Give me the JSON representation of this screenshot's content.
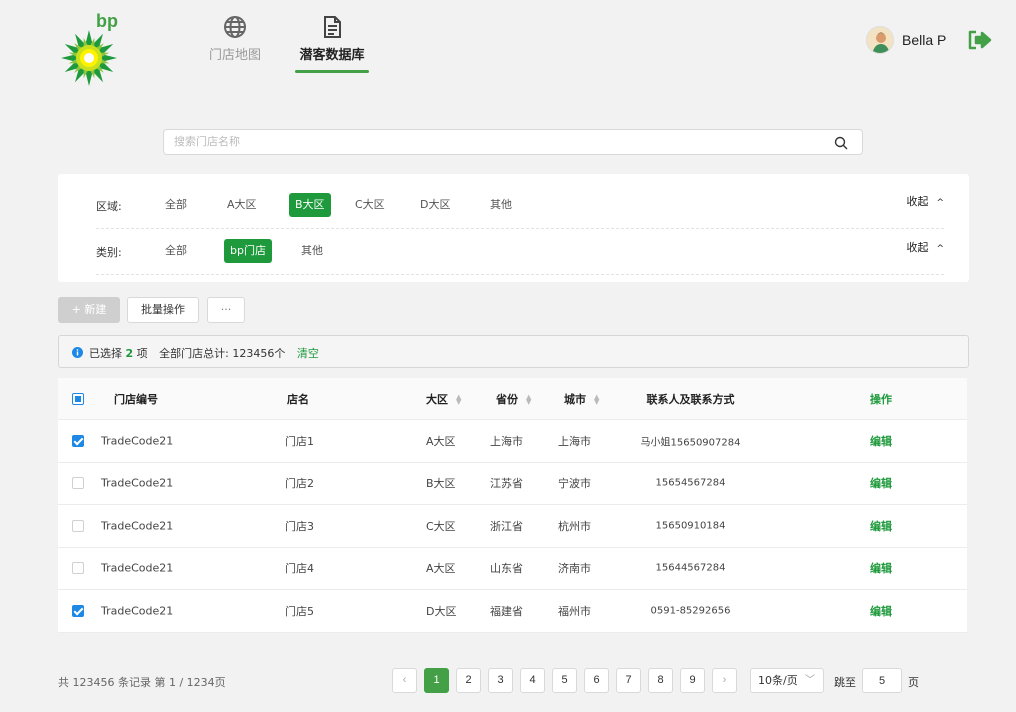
{
  "brand": {
    "logo_text": "bp",
    "accent": "#1e9a3c"
  },
  "nav": {
    "items": [
      {
        "label": "门店地图",
        "icon": "globe-icon",
        "active": false
      },
      {
        "label": "潜客数据库",
        "icon": "document-icon",
        "active": true
      }
    ]
  },
  "user": {
    "name": "Bella P",
    "avatar": "avatar",
    "logout_icon": "logout-icon"
  },
  "search": {
    "placeholder": "搜索门店名称",
    "value": ""
  },
  "filters": {
    "rows": [
      {
        "label": "区域:",
        "options": [
          "全部",
          "A大区",
          "B大区",
          "C大区",
          "D大区",
          "其他"
        ],
        "selected": "B大区",
        "toggle": "收起"
      },
      {
        "label": "类别:",
        "options": [
          "全部",
          "bp门店",
          "其他"
        ],
        "selected": "bp门店",
        "toggle": "收起"
      }
    ]
  },
  "toolbar": {
    "new_label": "+ 新建",
    "batch_label": "批量操作",
    "more_label": "···"
  },
  "alert": {
    "prefix": "已选择",
    "selected_count": "2",
    "unit": "项",
    "total_label": "全部门店总计: 123456个",
    "clear_label": "清空"
  },
  "table": {
    "columns": [
      "门店编号",
      "店名",
      "大区",
      "省份",
      "城市",
      "联系人及联系方式",
      "操作"
    ],
    "rows": [
      {
        "checked": true,
        "code": "TradeCode21",
        "name": "门店1",
        "region": "A大区",
        "province": "上海市",
        "city": "上海市",
        "contact": "马小姐15650907284",
        "action": "编辑"
      },
      {
        "checked": false,
        "code": "TradeCode21",
        "name": "门店2",
        "region": "B大区",
        "province": "江苏省",
        "city": "宁波市",
        "contact": "15654567284",
        "action": "编辑"
      },
      {
        "checked": false,
        "code": "TradeCode21",
        "name": "门店3",
        "region": "C大区",
        "province": "浙江省",
        "city": "杭州市",
        "contact": "15650910184",
        "action": "编辑"
      },
      {
        "checked": false,
        "code": "TradeCode21",
        "name": "门店4",
        "region": "A大区",
        "province": "山东省",
        "city": "济南市",
        "contact": "15644567284",
        "action": "编辑"
      },
      {
        "checked": true,
        "code": "TradeCode21",
        "name": "门店5",
        "region": "D大区",
        "province": "福建省",
        "city": "福州市",
        "contact": "0591-85292656",
        "action": "编辑"
      }
    ]
  },
  "pagination": {
    "summary": "共 123456 条记录 第 1 / 1234页",
    "pages": [
      "1",
      "2",
      "3",
      "4",
      "5",
      "6",
      "7",
      "8",
      "9"
    ],
    "current": "1",
    "prev": "‹",
    "next": "›",
    "page_size": "10条/页",
    "jump_label": "跳至",
    "jump_value": "5",
    "page_suffix": "页"
  }
}
